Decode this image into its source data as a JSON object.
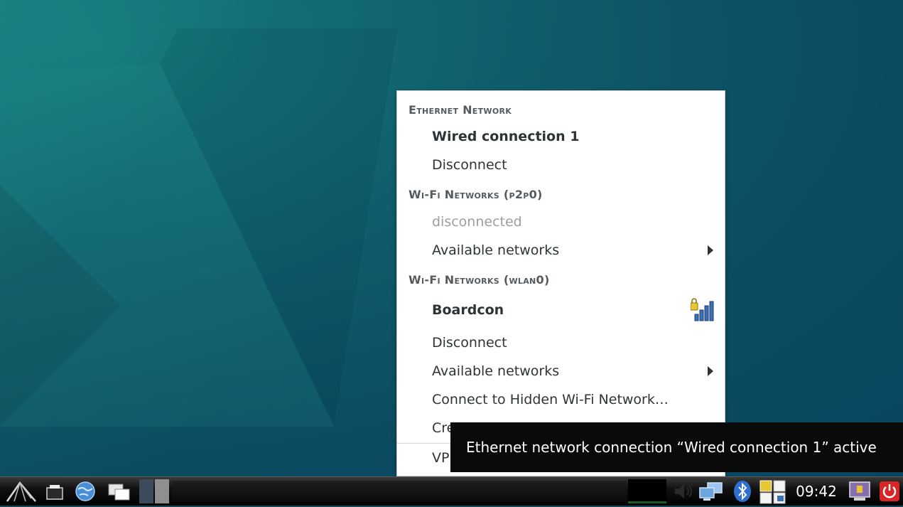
{
  "menu": {
    "sections": [
      {
        "header": "Ethernet Network"
      },
      {
        "header": "Wi-Fi Networks (p2p0)"
      },
      {
        "header": "Wi-Fi Networks (wlan0)"
      }
    ],
    "ethernet": {
      "connection": "Wired connection 1",
      "disconnect": "Disconnect"
    },
    "p2p0": {
      "status": "disconnected",
      "available": "Available networks"
    },
    "wlan0": {
      "connection": "Boardcon",
      "disconnect": "Disconnect",
      "available": "Available networks",
      "hidden": "Connect to Hidden Wi-Fi Network…",
      "create_partial": "Cre",
      "vpn_partial": "VP"
    }
  },
  "tooltip": {
    "text": "Ethernet network connection “Wired connection 1” active"
  },
  "taskbar": {
    "clock": "09:42"
  },
  "icons": {
    "start": "lxde-start-icon",
    "files": "file-manager-icon",
    "browser": "globe-icon",
    "windows": "window-switcher-icon",
    "volume": "volume-icon",
    "network": "network-icon",
    "bluetooth": "bluetooth-icon",
    "desktops": "desktop-pager-icon",
    "monitor": "monitor-icon",
    "power": "power-icon",
    "wifi_signal": "wifi-secure-signal-icon"
  },
  "colors": {
    "desktop_bg": "#0c4a5c",
    "menu_bg": "#ffffff",
    "tooltip_bg": "#0a0a0a",
    "power_red": "#d72626"
  }
}
